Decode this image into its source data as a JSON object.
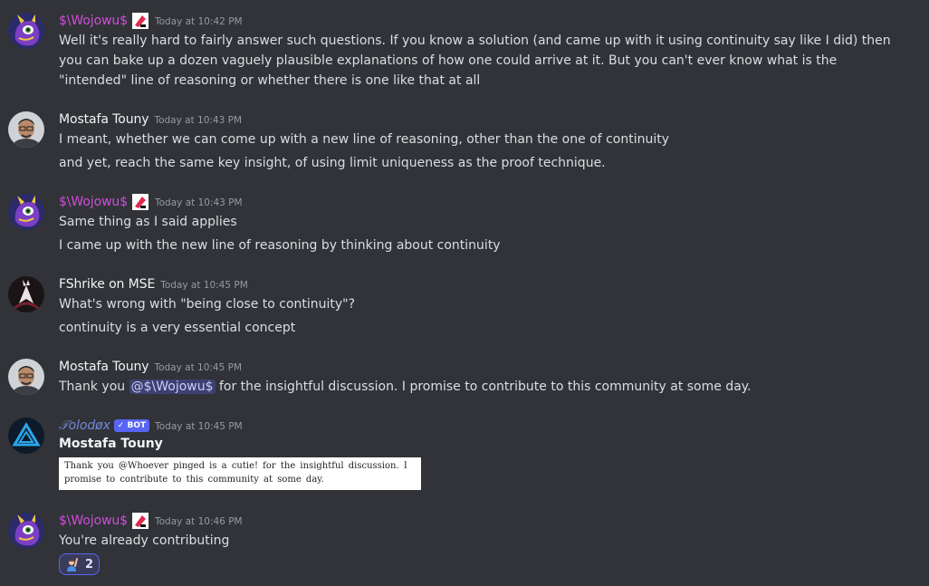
{
  "messages": [
    {
      "author": "$\\Wojowu$",
      "timestamp": "Today at 10:42 PM",
      "lines": [
        "Well it's really hard to fairly answer such questions. If you know a solution (and came up with it using continuity say like I did) then you can bake up a dozen vaguely plausible explanations of how one could arrive at it. But you can't ever know what is the \"intended\" line of reasoning or whether there is one like that at all"
      ]
    },
    {
      "author": "Mostafa Touny",
      "timestamp": "Today at 10:43 PM",
      "lines": [
        "I meant, whether we can come up with a new line of reasoning, other than the one of continuity",
        "and yet, reach the same key insight, of using limit uniqueness as the proof technique."
      ]
    },
    {
      "author": "$\\Wojowu$",
      "timestamp": "Today at 10:43 PM",
      "lines": [
        "Same thing as I said applies",
        "I came up with the new line of reasoning by thinking about continuity"
      ]
    },
    {
      "author": "FShrike on MSE",
      "timestamp": "Today at 10:45 PM",
      "lines": [
        "What's wrong with \"being close to continuity\"?",
        "continuity is a very essential concept"
      ]
    },
    {
      "author": "Mostafa Touny",
      "timestamp": "Today at 10:45 PM",
      "line_before_mention": "Thank you ",
      "mention": "@$\\Wojowu$",
      "line_after_mention": " for the insightful discussion. I promise to contribute to this community at some day."
    },
    {
      "author": "𝒯olodøx",
      "bot_tag": "✓ BOT",
      "timestamp": "Today at 10:45 PM",
      "embed_title": "Mostafa Touny",
      "embed_image_text": "Thank you @Whoever pinged is a cutie! for the insightful discussion. I promise to contribute to this community at some day."
    },
    {
      "author": "$\\Wojowu$",
      "timestamp": "Today at 10:46 PM",
      "lines": [
        "You're already contributing"
      ],
      "reaction": {
        "emoji": "person-raising-hand-emoji",
        "count": "2"
      }
    }
  ],
  "colors": {
    "background": "#313338",
    "wojowu_name": "#d24ddb",
    "text": "#dbdee1",
    "timestamp": "#949ba4",
    "mention_bg": "#5865f2",
    "bot_tag": "#5865f2"
  }
}
